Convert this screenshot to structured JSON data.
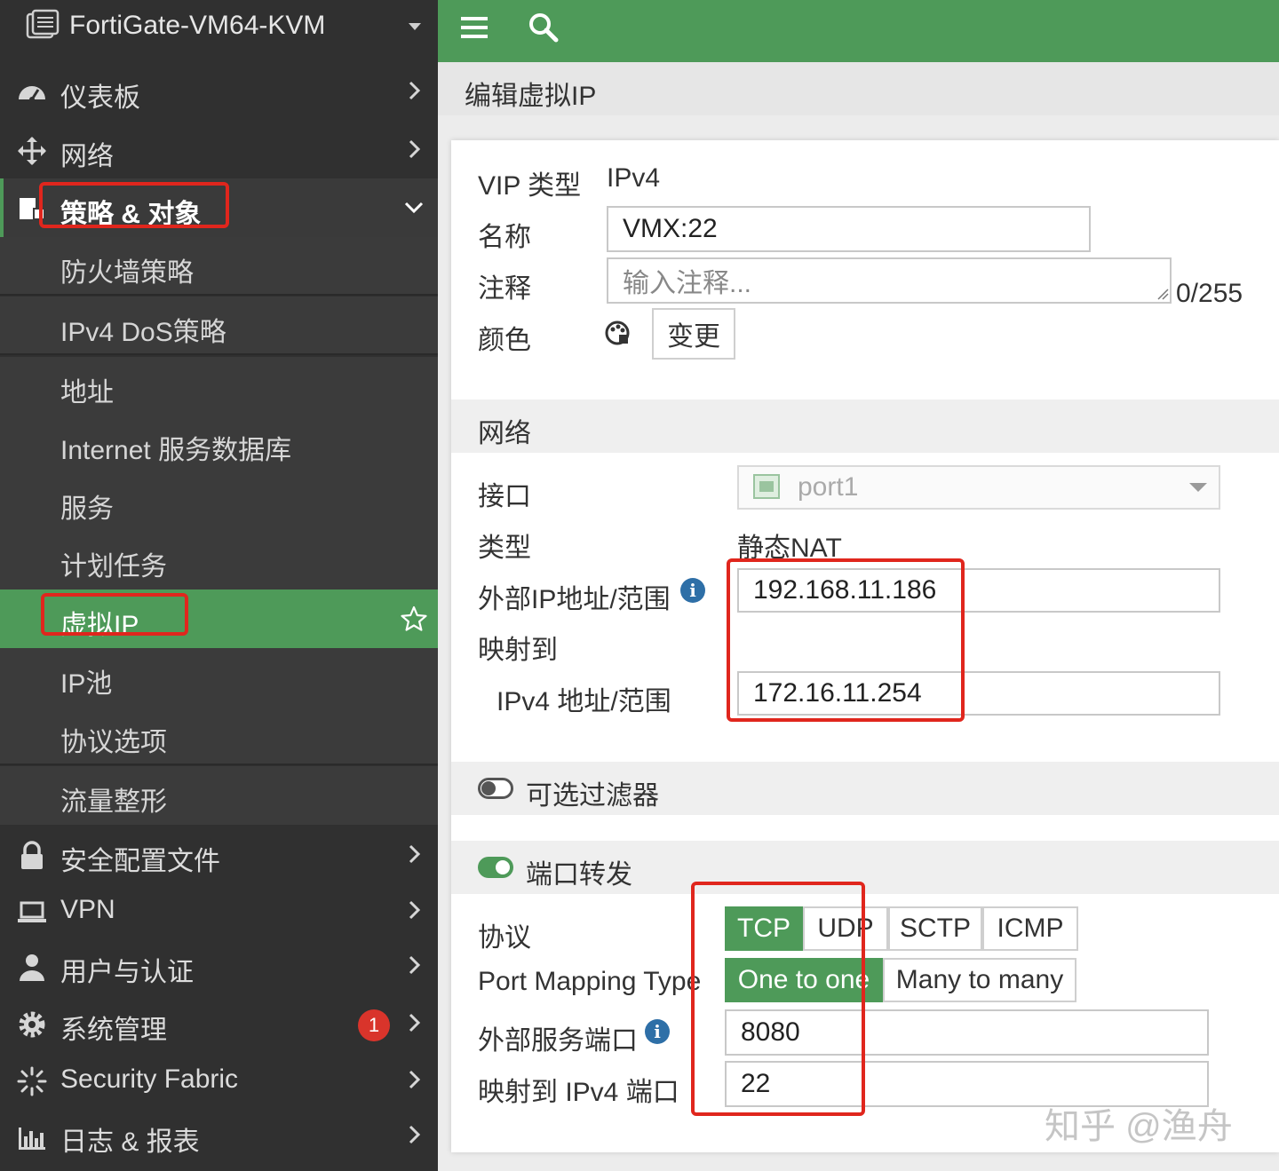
{
  "sidebar": {
    "device_name": "FortiGate-VM64-KVM",
    "items": [
      {
        "label": "仪表板"
      },
      {
        "label": "网络"
      },
      {
        "label": "策略 & 对象"
      },
      {
        "label": "安全配置文件"
      },
      {
        "label": "VPN"
      },
      {
        "label": "用户与认证"
      },
      {
        "label": "系统管理",
        "badge": "1"
      },
      {
        "label": "Security Fabric"
      },
      {
        "label": "日志 & 报表"
      }
    ],
    "sub_items": [
      {
        "label": "防火墙策略"
      },
      {
        "label": "IPv4 DoS策略"
      },
      {
        "label": "地址"
      },
      {
        "label": "Internet 服务数据库"
      },
      {
        "label": "服务"
      },
      {
        "label": "计划任务"
      },
      {
        "label": "虚拟IP"
      },
      {
        "label": "IP池"
      },
      {
        "label": "协议选项"
      },
      {
        "label": "流量整形"
      }
    ]
  },
  "page": {
    "title": "编辑虚拟IP"
  },
  "form": {
    "vip_type_label": "VIP 类型",
    "vip_type_value": "IPv4",
    "name_label": "名称",
    "name_value": "VMX:22",
    "comment_label": "注释",
    "comment_placeholder": "输入注释...",
    "comment_counter": "0/255",
    "color_label": "颜色",
    "color_button": "变更",
    "network_section": "网络",
    "interface_label": "接口",
    "interface_value": "port1",
    "type_label": "类型",
    "type_value": "静态NAT",
    "external_ip_label": "外部IP地址/范围",
    "external_ip_value": "192.168.11.186",
    "map_to_label": "映射到",
    "ipv4_range_label": "IPv4 地址/范围",
    "ipv4_range_value": "172.16.11.254",
    "optional_filter_label": "可选过滤器",
    "port_forward_label": "端口转发",
    "protocol_label": "协议",
    "protocols": [
      "TCP",
      "UDP",
      "SCTP",
      "ICMP"
    ],
    "port_mapping_label": "Port Mapping Type",
    "port_mapping_types": [
      "One to one",
      "Many to many"
    ],
    "ext_port_label": "外部服务端口",
    "ext_port_value": "8080",
    "map_port_label": "映射到 IPv4 端口",
    "map_port_value": "22"
  },
  "watermark": "知乎 @渔舟",
  "colors": {
    "accent": "#4e9a59",
    "sidebar_bg": "#303030",
    "highlight_red": "#e0261d"
  }
}
